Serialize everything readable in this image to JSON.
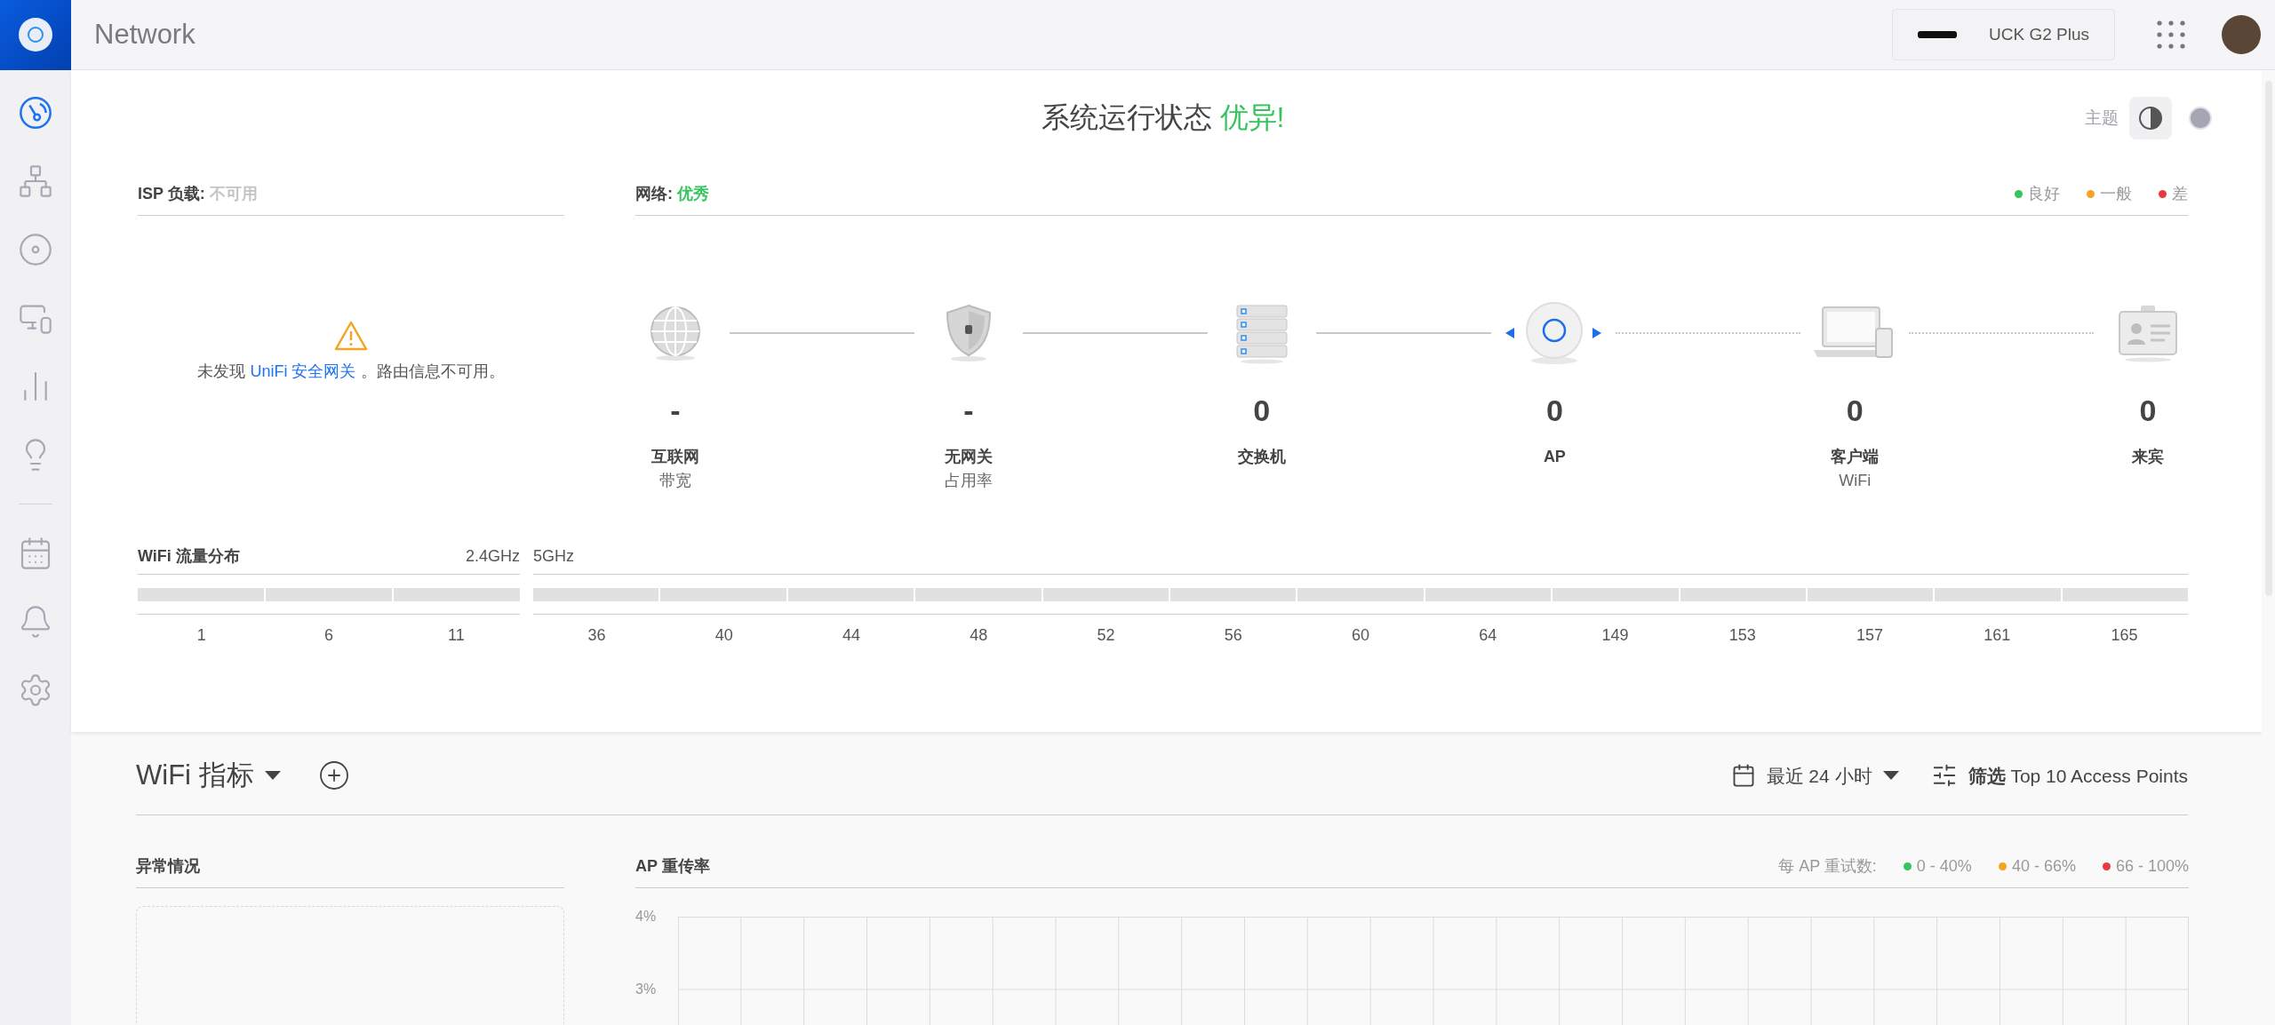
{
  "header": {
    "title": "Network",
    "device": "UCK G2 Plus"
  },
  "sidebar": {
    "items": [
      {
        "selected": true
      },
      {
        "selected": false
      },
      {
        "selected": false
      },
      {
        "selected": false
      },
      {
        "selected": false
      },
      {
        "selected": false
      },
      {
        "selected": false
      },
      {
        "selected": false
      },
      {
        "selected": false
      }
    ]
  },
  "status": {
    "title": "系统运行状态",
    "rating": "优异!"
  },
  "theme": {
    "label": "主题",
    "options": [
      {
        "kind": "contrast",
        "selected": true
      },
      {
        "kind": "dark",
        "selected": false
      }
    ]
  },
  "isp": {
    "label": "ISP 负载:",
    "value": "不可用",
    "message_before": "未发现",
    "link": "UniFi 安全网关",
    "message_after": "。路由信息不可用。"
  },
  "network": {
    "label": "网络:",
    "value": "优秀",
    "legend": [
      {
        "label": "良好",
        "color": "#35c45d"
      },
      {
        "label": "一般",
        "color": "#f2a520"
      },
      {
        "label": "差",
        "color": "#ea3a3f"
      }
    ],
    "nodes": [
      {
        "kind": "internet",
        "value": "-",
        "label": "互联网",
        "sublabel": "带宽"
      },
      {
        "kind": "gateway",
        "value": "-",
        "label": "无网关",
        "sublabel": "占用率"
      },
      {
        "kind": "switch",
        "value": "0",
        "label": "交换机"
      },
      {
        "kind": "ap",
        "value": "0",
        "label": "AP"
      },
      {
        "kind": "clients",
        "value": "0",
        "label": "客户端",
        "sublabel": "WiFi"
      },
      {
        "kind": "guests",
        "value": "0",
        "label": "来宾"
      }
    ],
    "links": [
      {
        "wireless": false
      },
      {
        "wireless": false
      },
      {
        "wireless": false
      },
      {
        "wireless": true
      },
      {
        "wireless": true
      }
    ]
  },
  "wifi_distribution": {
    "title": "WiFi 流量分布",
    "bands": [
      {
        "name": "2.4GHz",
        "channels": [
          "1",
          "6",
          "11"
        ]
      },
      {
        "name": "5GHz",
        "channels": [
          "36",
          "40",
          "44",
          "48",
          "52",
          "56",
          "60",
          "64",
          "149",
          "153",
          "157",
          "161",
          "165"
        ]
      }
    ]
  },
  "metrics": {
    "title": "WiFi 指标",
    "range": "最近 24 小时",
    "filter": "**筛选** Top 10 Access Points",
    "anomalies": {
      "title": "异常情况"
    },
    "retries": {
      "title": "AP 重传率",
      "legend_label": "每 AP 重试数:",
      "legend": [
        {
          "label": "0 - 40%",
          "color": "#35c45d"
        },
        {
          "label": "40 - 66%",
          "color": "#f2a520"
        },
        {
          "label": "66 - 100%",
          "color": "#ea3a3f"
        }
      ],
      "y_axis_labels": [
        "4%",
        "3%"
      ]
    }
  }
}
